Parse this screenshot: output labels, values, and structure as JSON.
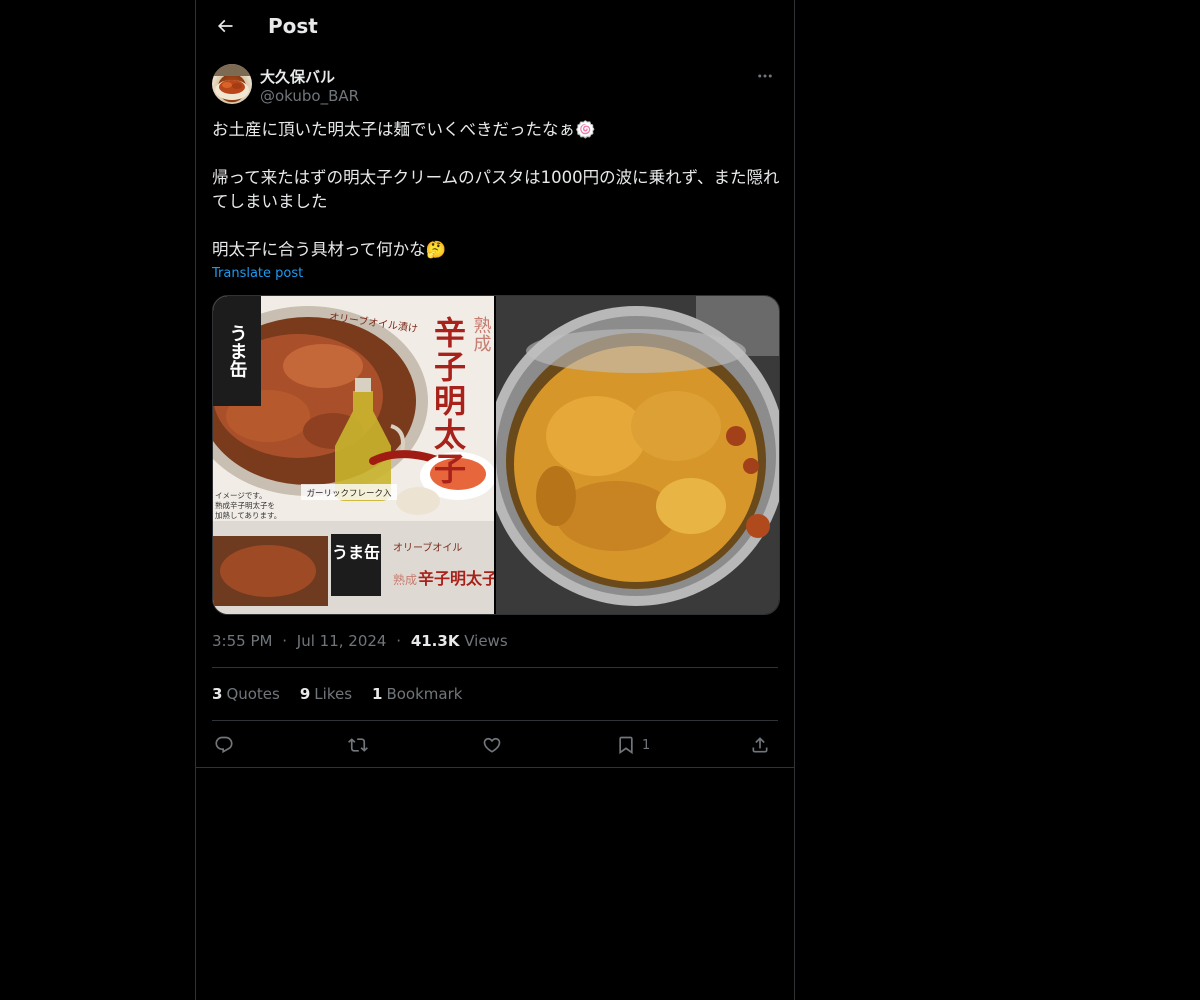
{
  "header": {
    "title": "Post",
    "back_icon": "arrow-left-icon"
  },
  "author": {
    "display_name": "大久保バル",
    "handle": "@okubo_BAR",
    "more_icon": "more-horizontal-icon"
  },
  "post": {
    "line1": "お土産に頂いた明太子は麺でいくべきだったなぁ🍥",
    "line2": "帰って来たはずの明太子クリームのパスタは1000円の波に乗れず、また隠れてしまいました",
    "line3": "明太子に合う具材って何かな🤔",
    "translate_label": "Translate post"
  },
  "media": {
    "left_photo": {
      "label_brand": "うま缶",
      "label_vertical": "辛子明太子",
      "label_small": "熟成",
      "label_oil": "オリーブオイル漬け",
      "label_garlic": "ガーリックフレーク入",
      "label_note1": "イメージです。",
      "label_note2": "熟成辛子明太子を",
      "label_note3": "加熱してあります。",
      "bottom_oil": "オリーブオイル",
      "bottom_name": "辛子明太子",
      "bottom_brand": "うま缶",
      "bottom_small": "熟成"
    },
    "right_photo": {
      "subject": "opened tin of mentaiko in olive oil"
    }
  },
  "meta": {
    "time": "3:55 PM",
    "separator": "·",
    "date": "Jul 11, 2024",
    "views_count": "41.3K",
    "views_label": "Views"
  },
  "stats": {
    "quotes_count": "3",
    "quotes_label": "Quotes",
    "likes_count": "9",
    "likes_label": "Likes",
    "bookmarks_count": "1",
    "bookmarks_label": "Bookmark"
  },
  "actions": {
    "reply_icon": "reply-icon",
    "repost_icon": "repost-icon",
    "like_icon": "heart-icon",
    "bookmark_icon": "bookmark-icon",
    "bookmark_count": "1",
    "share_icon": "share-icon"
  },
  "colors": {
    "background": "#000000",
    "text_primary": "#e7e9ea",
    "text_secondary": "#71767b",
    "link": "#1d9bf0",
    "border": "#2f3336"
  }
}
